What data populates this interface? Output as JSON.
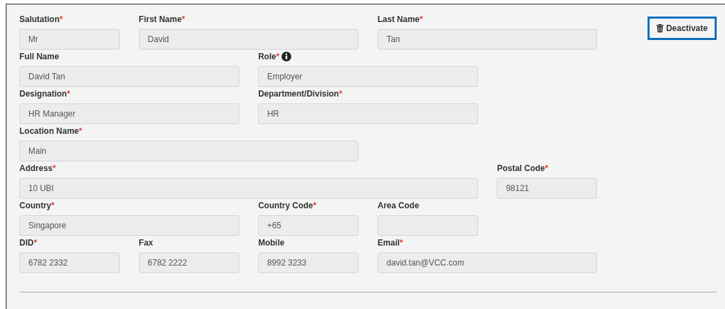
{
  "form": {
    "rows": [
      {
        "fields": [
          {
            "label": "Salutation",
            "required_mark": "*",
            "value": "Mr"
          },
          {
            "label": "First Name",
            "required_mark": "*",
            "value": "David"
          },
          {
            "label": "Last Name",
            "required_mark": "*",
            "value": "Tan"
          }
        ]
      },
      {
        "fields": [
          {
            "label": "Full Name",
            "value": "David Tan"
          },
          {
            "label": "Role",
            "required_mark": "*",
            "info": true,
            "value": "Employer"
          }
        ]
      },
      {
        "fields": [
          {
            "label": "Designation",
            "required_mark": "*",
            "value": "HR Manager"
          },
          {
            "label": "Department/Division",
            "required_mark": "*",
            "value": "HR"
          }
        ]
      },
      {
        "fields": [
          {
            "label": "Location Name",
            "required_mark": "*",
            "value": "Main"
          }
        ]
      },
      {
        "fields": [
          {
            "label": "Address",
            "required_mark": "*",
            "value": "10 UBI"
          },
          {
            "label": "Postal Code",
            "required_mark": "*",
            "value": "98121"
          }
        ]
      },
      {
        "fields": [
          {
            "label": "Country",
            "required_mark": "*",
            "value": "Singapore"
          },
          {
            "label": "Country Code",
            "required_mark": "*",
            "value": "+65"
          },
          {
            "label": "Area Code"
          }
        ]
      },
      {
        "fields": [
          {
            "label": "DID",
            "required_mark": "*",
            "value": "6782 2332"
          },
          {
            "label": "Fax",
            "value": "6782 2222"
          },
          {
            "label": "Mobile",
            "value": "8992 3233"
          },
          {
            "label": "Email",
            "required_mark": "*",
            "value": "david.tan@VCC.com"
          }
        ]
      }
    ]
  },
  "deactivate_button": {
    "label": "Deactivate"
  }
}
